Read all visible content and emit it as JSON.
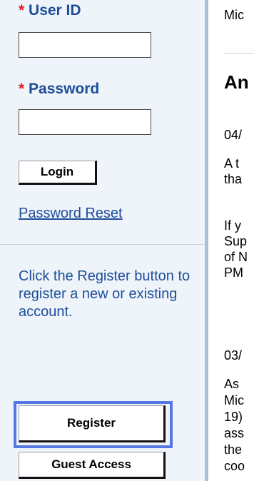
{
  "sidebar": {
    "userid_label": "User ID",
    "password_label": "Password",
    "required_marker": "*",
    "login_button": "Login",
    "password_reset_link": "Password Reset",
    "register_info": "Click the Register button to register a new or existing account.",
    "register_button": "Register",
    "guest_button": "Guest Access"
  },
  "main": {
    "top_text": "Mic",
    "heading": "An",
    "date1": "04/",
    "para1_line1": "A t",
    "para1_line2": "tha",
    "para2_line1": "If y",
    "para2_line2": "Sup",
    "para2_line3": "of N",
    "para2_line4": "PM",
    "date2": "03/",
    "para3_line1": "As",
    "para3_line2": "Mic",
    "para3_line3": "19)",
    "para3_line4": "ass",
    "para3_line5": "the",
    "para3_line6": "coo"
  },
  "colors": {
    "label_blue": "#1d4d99",
    "required_red": "#e51b24",
    "highlight": "#5477e3",
    "sidebar_bg": "#eff4fa"
  }
}
